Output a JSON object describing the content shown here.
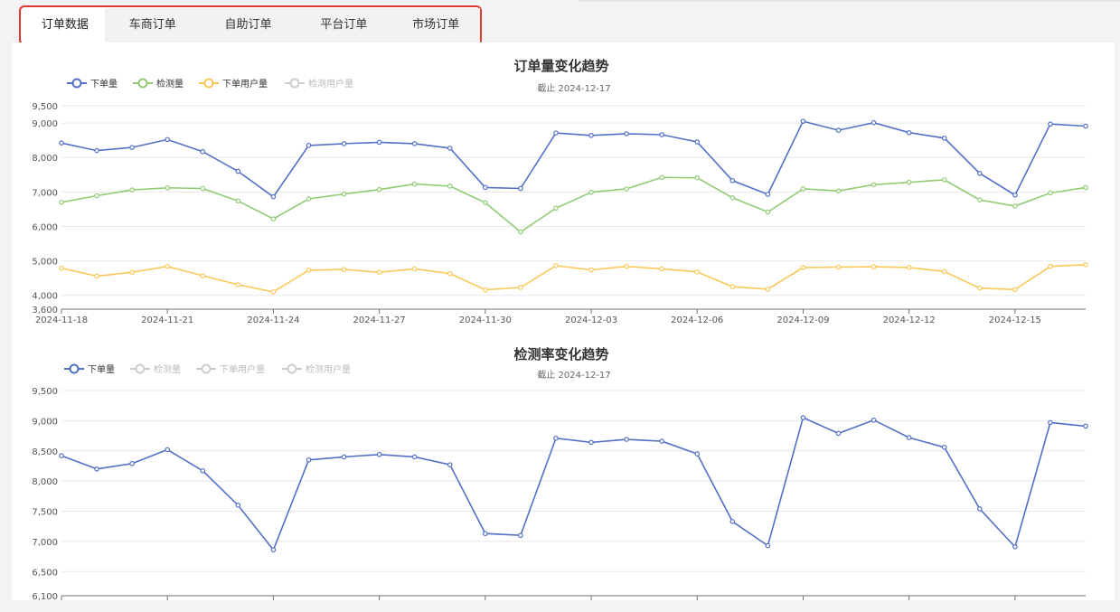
{
  "tabs": [
    {
      "label": "订单数据",
      "active": true
    },
    {
      "label": "车商订单",
      "active": false
    },
    {
      "label": "自助订单",
      "active": false
    },
    {
      "label": "平台订单",
      "active": false
    },
    {
      "label": "市场订单",
      "active": false
    }
  ],
  "chart_data": [
    {
      "type": "line",
      "title": "订单量变化趋势",
      "subtitle": "截止 2024-12-17",
      "legend_placement": "top-left",
      "grid": true,
      "ylim": [
        3600,
        9500
      ],
      "yticks": [
        3600,
        4000,
        5000,
        6000,
        7000,
        8000,
        9000,
        9500
      ],
      "ytick_labels": [
        "3,600",
        "4,000",
        "5,000",
        "6,000",
        "7,000",
        "8,000",
        "9,000",
        "9,500"
      ],
      "x": [
        "2024-11-18",
        "2024-11-19",
        "2024-11-20",
        "2024-11-21",
        "2024-11-22",
        "2024-11-23",
        "2024-11-24",
        "2024-11-25",
        "2024-11-26",
        "2024-11-27",
        "2024-11-28",
        "2024-11-29",
        "2024-11-30",
        "2024-12-01",
        "2024-12-02",
        "2024-12-03",
        "2024-12-04",
        "2024-12-05",
        "2024-12-06",
        "2024-12-07",
        "2024-12-08",
        "2024-12-09",
        "2024-12-10",
        "2024-12-11",
        "2024-12-12",
        "2024-12-13",
        "2024-12-14",
        "2024-12-15",
        "2024-12-16",
        "2024-12-17"
      ],
      "xtick_labels": [
        "2024-11-18",
        "2024-11-21",
        "2024-11-24",
        "2024-11-27",
        "2024-11-30",
        "2024-12-03",
        "2024-12-06",
        "2024-12-09",
        "2024-12-12",
        "2024-12-15"
      ],
      "series": [
        {
          "name": "下单量",
          "color": "#5470c6",
          "visible": true,
          "values": [
            8420,
            8200,
            8290,
            8520,
            8170,
            7600,
            6860,
            8350,
            8400,
            8440,
            8400,
            8270,
            7130,
            7100,
            8710,
            8640,
            8690,
            8660,
            8450,
            7330,
            6930,
            9050,
            8790,
            9010,
            8720,
            8560,
            7540,
            6910,
            8970,
            8910
          ]
        },
        {
          "name": "检测量",
          "color": "#91cc75",
          "visible": true,
          "values": [
            6700,
            6890,
            7060,
            7120,
            7100,
            6740,
            6220,
            6800,
            6940,
            7070,
            7230,
            7170,
            6690,
            5840,
            6530,
            6990,
            7090,
            7420,
            7410,
            6830,
            6420,
            7090,
            7030,
            7210,
            7280,
            7350,
            6770,
            6590,
            6970,
            7130
          ]
        },
        {
          "name": "下单用户量",
          "color": "#fac858",
          "visible": true,
          "values": [
            4790,
            4560,
            4670,
            4840,
            4570,
            4310,
            4100,
            4730,
            4750,
            4670,
            4770,
            4630,
            4160,
            4230,
            4860,
            4740,
            4840,
            4770,
            4680,
            4250,
            4180,
            4810,
            4820,
            4830,
            4810,
            4690,
            4210,
            4170,
            4840,
            4890
          ]
        },
        {
          "name": "检测用户量",
          "color": "#bbbbbb",
          "visible": false,
          "values": []
        }
      ]
    },
    {
      "type": "line",
      "title": "检测率变化趋势",
      "subtitle": "截止 2024-12-17",
      "legend_placement": "top-left",
      "grid": true,
      "ylim": [
        6100,
        9500
      ],
      "yticks": [
        6100,
        6500,
        7000,
        7500,
        8000,
        8500,
        9000,
        9500
      ],
      "ytick_labels": [
        "6,100",
        "6,500",
        "7,000",
        "7,500",
        "8,000",
        "8,500",
        "9,000",
        "9,500"
      ],
      "series": [
        {
          "name": "下单量",
          "color": "#5470c6",
          "visible": true,
          "values": [
            8420,
            8200,
            8290,
            8520,
            8170,
            7600,
            6860,
            8350,
            8400,
            8440,
            8400,
            8270,
            7130,
            7100,
            8710,
            8640,
            8690,
            8660,
            8450,
            7330,
            6930,
            9050,
            8790,
            9010,
            8720,
            8560,
            7540,
            6910,
            8970,
            8910
          ]
        },
        {
          "name": "检测量",
          "color": "#bbbbbb",
          "visible": false,
          "values": []
        },
        {
          "name": "下单用户量",
          "color": "#bbbbbb",
          "visible": false,
          "values": []
        },
        {
          "name": "检测用户量",
          "color": "#bbbbbb",
          "visible": false,
          "values": []
        }
      ]
    }
  ]
}
